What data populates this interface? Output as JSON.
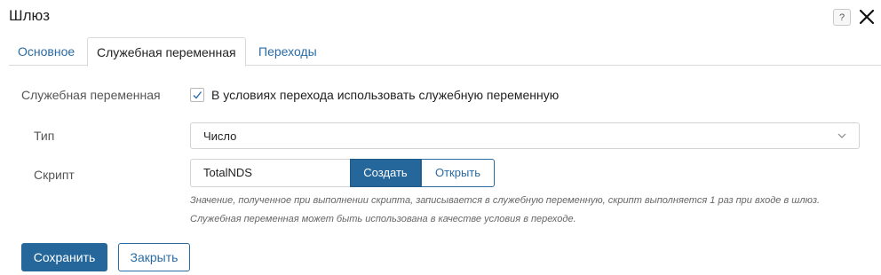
{
  "dialog": {
    "title": "Шлюз",
    "help_label": "?",
    "close_icon": "close-icon"
  },
  "tabs": [
    {
      "label": "Основное",
      "active": false
    },
    {
      "label": "Служебная переменная",
      "active": true
    },
    {
      "label": "Переходы",
      "active": false
    }
  ],
  "form": {
    "service_variable": {
      "label": "Служебная переменная",
      "checkbox_label": "В условиях перехода использовать служебную переменную",
      "checked": true
    },
    "type": {
      "label": "Тип",
      "value": "Число"
    },
    "script": {
      "label": "Скрипт",
      "value": "TotalNDS",
      "create_label": "Создать",
      "open_label": "Открыть",
      "hint1": "Значение, полученное при выполнении скрипта, записывается в служебную переменную, скрипт выполняется 1 раз при входе в шлюз.",
      "hint2": "Служебная переменная может быть использована в качестве условия в переходе."
    }
  },
  "footer": {
    "save_label": "Сохранить",
    "close_label": "Закрыть"
  },
  "colors": {
    "primary": "#25679a",
    "link": "#2b6ba3"
  }
}
